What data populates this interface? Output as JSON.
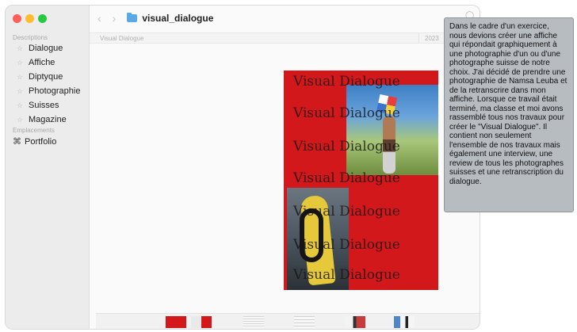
{
  "window": {
    "title": "visual_dialogue"
  },
  "sidebar": {
    "sections": [
      {
        "title": "Descriptions",
        "items": [
          "Dialogue",
          "Affiche",
          "Diptyque",
          "Photographie",
          "Suisses",
          "Magazine"
        ]
      },
      {
        "title": "Emplacements",
        "items": [
          "Portfolio"
        ]
      }
    ]
  },
  "columns": {
    "name": "Visual Dialogue",
    "date": "2023"
  },
  "preview": {
    "lines": [
      "Visual Dialogue",
      "Visual Dialogue",
      "Visual Dialogue",
      "Visual Dialogue",
      "Visual Dialogue",
      "Visual Dialogue",
      "Visual Dialogue"
    ]
  },
  "tooltip": {
    "text": "Dans le cadre d'un exercice, nous devions créer une affiche qui répondait graphiquement à une photographie d'un ou d'une photographe suisse de notre choix. J'ai décidé de prendre une photographie de Namsa Leuba et de la retranscrire dans mon affiche. Lorsque ce travail était terminé, ma classe et moi avons rassemblé tous nos travaux pour créer le \"Visual Dialogue\". Il contient non seulement l'ensemble de nos travaux mais également une interview, une review de tous les photographes suisses et une retranscription du dialogue."
  },
  "icons": {
    "back": "chevron-left-icon",
    "forward": "chevron-right-icon",
    "folder": "folder-icon",
    "favorite": "star-icon",
    "portfolio": "portfolio-icon"
  },
  "colors": {
    "poster_red": "#d3181c",
    "folder_blue": "#5aa9e6",
    "tooltip_bg": "#b7bcc0"
  }
}
